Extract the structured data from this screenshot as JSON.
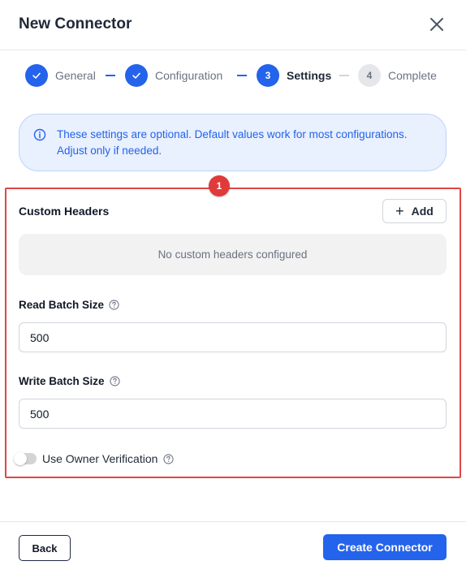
{
  "modal": {
    "title": "New Connector",
    "close_icon": "close-icon"
  },
  "stepper": {
    "steps": [
      {
        "number": "1",
        "label": "General",
        "state": "done"
      },
      {
        "number": "2",
        "label": "Configuration",
        "state": "done"
      },
      {
        "number": "3",
        "label": "Settings",
        "state": "active"
      },
      {
        "number": "4",
        "label": "Complete",
        "state": "pending"
      }
    ]
  },
  "info": {
    "icon": "info-icon",
    "text": "These settings are optional. Default values work for most configurations. Adjust only if needed."
  },
  "annotation": {
    "badge": "1",
    "color": "#e04646"
  },
  "custom_headers": {
    "title": "Custom Headers",
    "add_label": "Add",
    "empty_text": "No custom headers configured"
  },
  "read_batch": {
    "label": "Read Batch Size",
    "value": "500"
  },
  "write_batch": {
    "label": "Write Batch Size",
    "value": "500"
  },
  "owner_verification": {
    "label": "Use Owner Verification",
    "enabled": false
  },
  "footer": {
    "back_label": "Back",
    "create_label": "Create Connector"
  },
  "colors": {
    "accent": "#2463eb",
    "info_bg": "#e9f0fe",
    "highlight": "#e04646"
  }
}
